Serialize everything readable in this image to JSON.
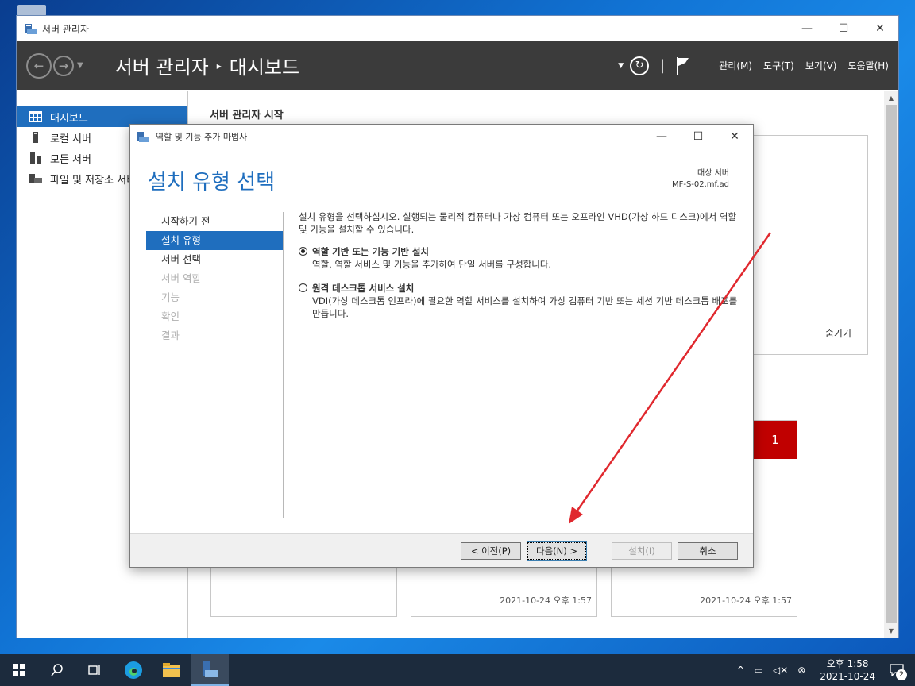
{
  "window": {
    "title": "서버 관리자"
  },
  "header": {
    "breadcrumb_root": "서버 관리자",
    "breadcrumb_sep": "▸",
    "breadcrumb_page": "대시보드",
    "menus": [
      "관리(M)",
      "도구(T)",
      "보기(V)",
      "도움말(H)"
    ]
  },
  "sidebar": {
    "items": [
      {
        "label": "대시보드",
        "icon": "dashboard-icon"
      },
      {
        "label": "로컬 서버",
        "icon": "local-server-icon"
      },
      {
        "label": "모든 서버",
        "icon": "all-servers-icon"
      },
      {
        "label": "파일 및 저장소 서비스",
        "icon": "file-storage-icon"
      }
    ]
  },
  "main": {
    "title": "서버 관리자 시작",
    "hide_label": "숨기기",
    "tile_badge": "1",
    "tile_timestamps": [
      "2021-10-24 오후 1:57",
      "2021-10-24 오후 1:57"
    ]
  },
  "wizard": {
    "title": "역할 및 기능 추가 마법사",
    "heading": "설치 유형 선택",
    "dest_label": "대상 서버",
    "dest_value": "MF-S-02.mf.ad",
    "nav": [
      {
        "label": "시작하기 전",
        "state": "normal"
      },
      {
        "label": "설치 유형",
        "state": "active"
      },
      {
        "label": "서버 선택",
        "state": "normal"
      },
      {
        "label": "서버 역할",
        "state": "disabled"
      },
      {
        "label": "기능",
        "state": "disabled"
      },
      {
        "label": "확인",
        "state": "disabled"
      },
      {
        "label": "결과",
        "state": "disabled"
      }
    ],
    "intro": "설치 유형을 선택하십시오. 실행되는 물리적 컴퓨터나 가상 컴퓨터 또는 오프라인 VHD(가상 하드 디스크)에서 역할 및 기능을 설치할 수 있습니다.",
    "options": [
      {
        "title": "역할 기반 또는 기능 기반 설치",
        "desc": "역할, 역할 서비스 및 기능을 추가하여 단일 서버를 구성합니다.",
        "checked": true
      },
      {
        "title": "원격 데스크톱 서비스 설치",
        "desc": "VDI(가상 데스크톱 인프라)에 필요한 역할 서비스를 설치하여 가상 컴퓨터 기반 또는 세션 기반 데스크톱 배포를 만듭니다.",
        "checked": false
      }
    ],
    "buttons": {
      "prev": "< 이전(P)",
      "next": "다음(N) >",
      "install": "설치(I)",
      "cancel": "취소"
    }
  },
  "taskbar": {
    "clock_time": "오후 1:58",
    "clock_date": "2021-10-24",
    "notification_count": "2"
  },
  "colors": {
    "accent": "#1f6ebe",
    "header_bg": "#3b3b3b",
    "alert_red": "#c00000",
    "annotation_arrow": "#e0282e"
  }
}
